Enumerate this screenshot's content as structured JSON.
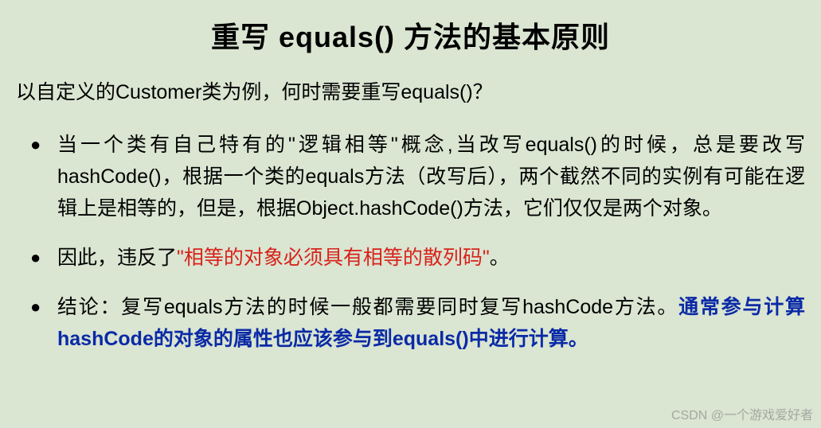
{
  "title": "重写 equals() 方法的基本原则",
  "intro": "以自定义的Customer类为例，何时需要重写equals()？",
  "points": {
    "p1": "当一个类有自己特有的\"逻辑相等\"概念,当改写equals()的时候，总是要改写hashCode()，根据一个类的equals方法（改写后），两个截然不同的实例有可能在逻辑上是相等的，但是，根据Object.hashCode()方法，它们仅仅是两个对象。",
    "p2_prefix": "因此，违反了",
    "p2_red": "\"相等的对象必须具有相等的散列码\"",
    "p2_suffix": "。",
    "p3_prefix": "结论：复写equals方法的时候一般都需要同时复写hashCode方法。",
    "p3_blue": "通常参与计算hashCode的对象的属性也应该参与到equals()中进行计算。"
  },
  "watermark": "CSDN @一个游戏爱好者"
}
